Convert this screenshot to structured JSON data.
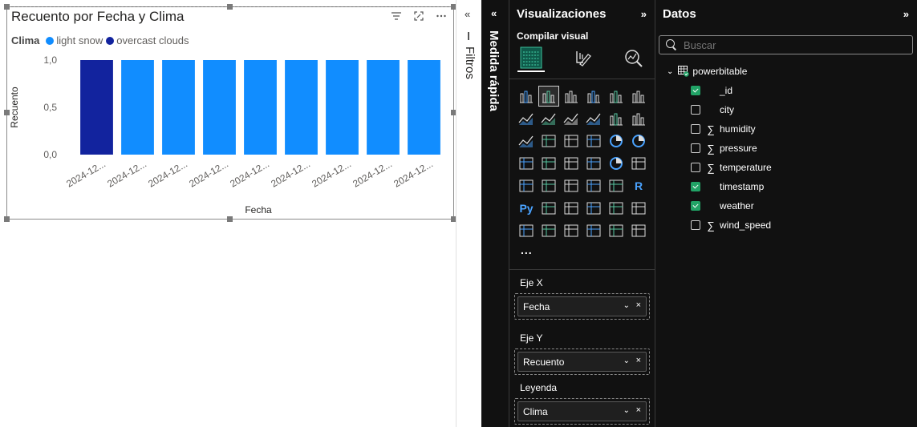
{
  "chart": {
    "title": "Recuento por Fecha y Clima",
    "legend_title": "Clima",
    "legend": [
      {
        "label": "light snow",
        "color": "#118dff"
      },
      {
        "label": "overcast clouds",
        "color": "#12239e"
      }
    ],
    "icons": [
      "filter-icon",
      "focus-mode-icon",
      "more-options-icon"
    ]
  },
  "chart_data": {
    "type": "bar",
    "title": "Recuento por Fecha y Clima",
    "xlabel": "Fecha",
    "ylabel": "Recuento",
    "ylim": [
      0,
      1
    ],
    "yticks": [
      "0,0",
      "0,5",
      "1,0"
    ],
    "categories": [
      "2024-12...",
      "2024-12...",
      "2024-12...",
      "2024-12...",
      "2024-12...",
      "2024-12...",
      "2024-12...",
      "2024-12...",
      "2024-12..."
    ],
    "series": [
      {
        "name": "light snow",
        "color": "#118dff",
        "values": [
          0,
          1,
          1,
          1,
          1,
          1,
          1,
          1,
          1
        ]
      },
      {
        "name": "overcast clouds",
        "color": "#12239e",
        "values": [
          1,
          0,
          0,
          0,
          0,
          0,
          0,
          0,
          0
        ]
      }
    ],
    "legend_position": "top-left",
    "grid": false
  },
  "filters": {
    "label": "Filtros",
    "collapse_glyph": "«"
  },
  "quick_measure": {
    "label": "Medida rápida",
    "collapse_glyph": "«"
  },
  "visualizations": {
    "title": "Visualizaciones",
    "expand_glyph": "»",
    "build_label": "Compilar visual",
    "build_tabs": [
      "build-visual-icon",
      "format-visual-icon",
      "analytics-icon"
    ],
    "more": "...",
    "wells": [
      {
        "label": "Eje X",
        "field": "Fecha"
      },
      {
        "label": "Eje Y",
        "field": "Recuento"
      },
      {
        "label": "Leyenda",
        "field": "Clima"
      }
    ],
    "close_glyph": "×"
  },
  "data_pane": {
    "title": "Datos",
    "expand_glyph": "»",
    "search_placeholder": "Buscar",
    "table": "powerbitable",
    "fields": [
      {
        "name": "_id",
        "checked": true,
        "sigma": false
      },
      {
        "name": "city",
        "checked": false,
        "sigma": false
      },
      {
        "name": "humidity",
        "checked": false,
        "sigma": true
      },
      {
        "name": "pressure",
        "checked": false,
        "sigma": true
      },
      {
        "name": "temperature",
        "checked": false,
        "sigma": true
      },
      {
        "name": "timestamp",
        "checked": true,
        "sigma": false
      },
      {
        "name": "weather",
        "checked": true,
        "sigma": false
      },
      {
        "name": "wind_speed",
        "checked": false,
        "sigma": true
      }
    ],
    "sigma_glyph": "∑"
  }
}
